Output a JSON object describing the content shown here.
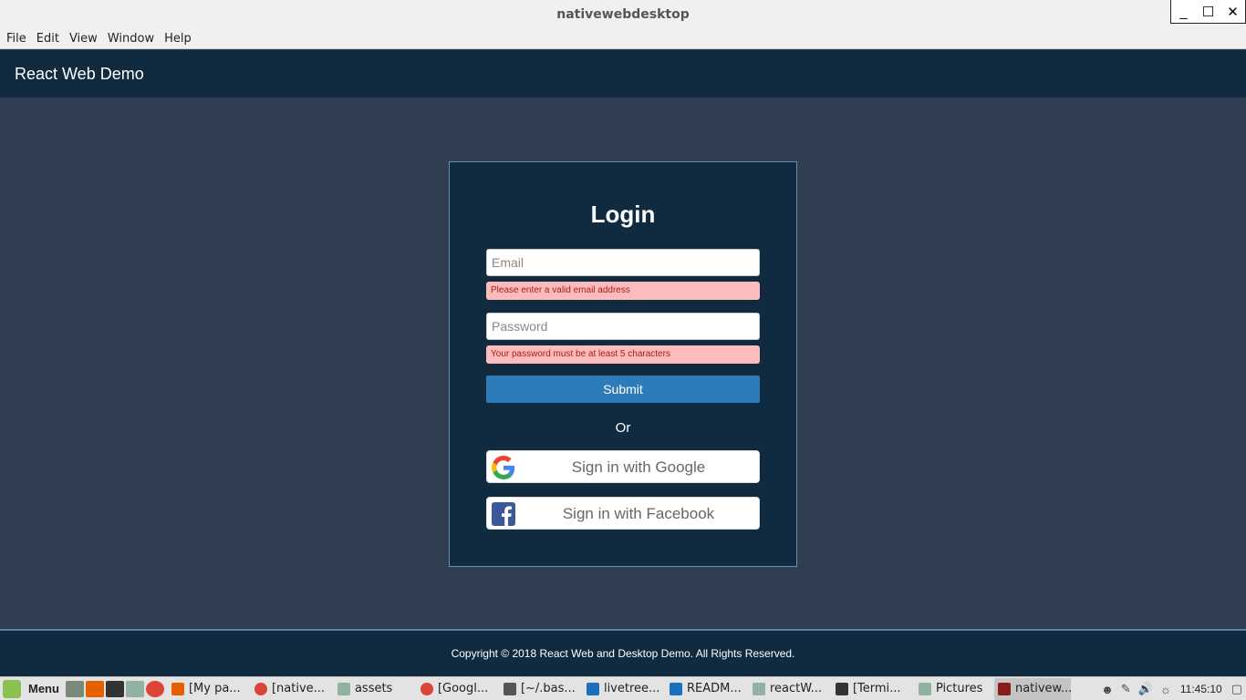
{
  "window": {
    "title": "nativewebdesktop",
    "controls": {
      "minimize": "_",
      "maximize": "☐",
      "close": "✕"
    }
  },
  "menubar": [
    "File",
    "Edit",
    "View",
    "Window",
    "Help"
  ],
  "app": {
    "brand": "React Web Demo"
  },
  "login": {
    "title": "Login",
    "email_placeholder": "Email",
    "email_error": "Please enter a valid email address",
    "password_placeholder": "Password",
    "password_error": "Your password must be at least 5 characters",
    "submit_label": "Submit",
    "or_label": "Or",
    "google_label": "Sign in with Google",
    "facebook_label": "Sign in with Facebook"
  },
  "footer": {
    "copyright": "Copyright © 2018 React Web and Desktop Demo. All Rights Reserved."
  },
  "taskbar": {
    "menu_label": "Menu",
    "items": [
      "[My pa...",
      "[native...",
      "assets",
      "[Googl...",
      "[~/.bas...",
      "livetree...",
      "READM...",
      "reactW...",
      "[Termi...",
      "Pictures",
      "nativew..."
    ],
    "clock": "11:45:10"
  },
  "colors": {
    "header_bg": "#102b40",
    "content_bg": "#2f3e50",
    "submit_bg": "#2e7bb9",
    "error_bg": "#fcbcbc",
    "facebook_blue": "#3b5998"
  }
}
